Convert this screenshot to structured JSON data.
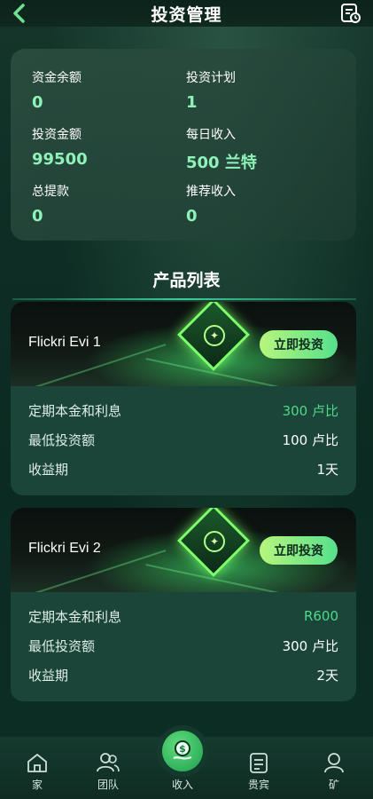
{
  "header": {
    "title": "投资管理",
    "back_icon": "back-chevron-icon",
    "record_icon": "history-record-icon"
  },
  "stats": {
    "balance": {
      "label": "资金余额",
      "value": "0"
    },
    "plans": {
      "label": "投资计划",
      "value": "1"
    },
    "invested": {
      "label": "投资金额",
      "value": "99500"
    },
    "daily_income": {
      "label": "每日收入",
      "value": "500 兰特"
    },
    "total_withdrawn": {
      "label": "总提款",
      "value": "0"
    },
    "referral_income": {
      "label": "推荐收入",
      "value": "0"
    }
  },
  "section_title": "产品列表",
  "products": [
    {
      "name": "Flickri Evi 1",
      "button": "立即投资",
      "rows": [
        {
          "label": "定期本金和利息",
          "value": "300 卢比"
        },
        {
          "label": "最低投资额",
          "value": "100 卢比"
        },
        {
          "label": "收益期",
          "value": "1天"
        }
      ]
    },
    {
      "name": "Flickri Evi 2",
      "button": "立即投资",
      "rows": [
        {
          "label": "定期本金和利息",
          "value": "R600"
        },
        {
          "label": "最低投资额",
          "value": "300 卢比"
        },
        {
          "label": "收益期",
          "value": "2天"
        }
      ]
    }
  ],
  "nav": [
    {
      "label": "家",
      "icon": "home-icon"
    },
    {
      "label": "团队",
      "icon": "team-icon"
    },
    {
      "label": "收入",
      "icon": "income-icon"
    },
    {
      "label": "贵宾",
      "icon": "vip-document-icon"
    },
    {
      "label": "矿",
      "icon": "profile-icon"
    }
  ],
  "colors": {
    "accent_value": "#8ff2b8",
    "profit_value": "#4fd98b",
    "button_gradient_start": "#b7f57d",
    "button_gradient_end": "#56e08c"
  }
}
